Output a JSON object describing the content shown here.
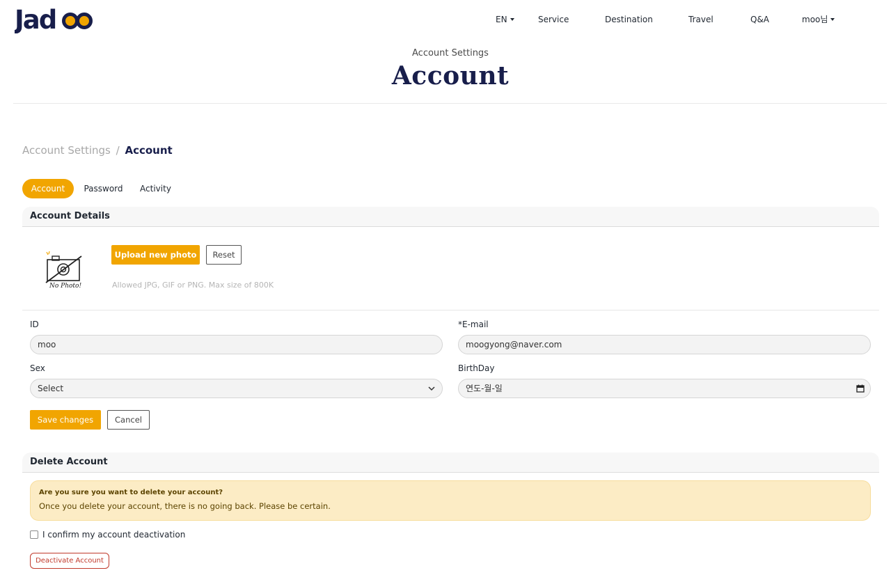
{
  "brand": {
    "logo_text": "Jadoo"
  },
  "nav": {
    "lang": "EN",
    "items": [
      "Service",
      "Destination",
      "Travel",
      "Q&A"
    ],
    "user": "moo님"
  },
  "page": {
    "subtitle": "Account Settings",
    "title": "Account"
  },
  "breadcrumb": {
    "parent": "Account Settings",
    "separator": "/",
    "current": "Account"
  },
  "tabs": [
    {
      "label": "Account",
      "active": true
    },
    {
      "label": "Password",
      "active": false
    },
    {
      "label": "Activity",
      "active": false
    }
  ],
  "account_details": {
    "heading": "Account Details",
    "photo_alt": "No Photo!",
    "upload_label": "Upload new photo",
    "reset_label": "Reset",
    "hint": "Allowed JPG, GIF or PNG. Max size of 800K"
  },
  "form": {
    "id_label": "ID",
    "id_value": "moo",
    "email_label": "*E-mail",
    "email_value": "moogyong@naver.com",
    "sex_label": "Sex",
    "sex_value": "Select",
    "birthday_label": "BirthDay",
    "birthday_placeholder": "연도-월-일",
    "save_label": "Save changes",
    "cancel_label": "Cancel"
  },
  "delete_account": {
    "heading": "Delete Account",
    "warning_title": "Are you sure you want to delete your account?",
    "warning_body": "Once you delete your account, there is no going back. Please be certain.",
    "confirm_label": "I confirm my account deactivation",
    "deactivate_label": "Deactivate Account"
  },
  "colors": {
    "accent": "#f1a501",
    "navy": "#181e4b",
    "danger": "#c0392b",
    "warning_bg": "#fcecc5"
  }
}
